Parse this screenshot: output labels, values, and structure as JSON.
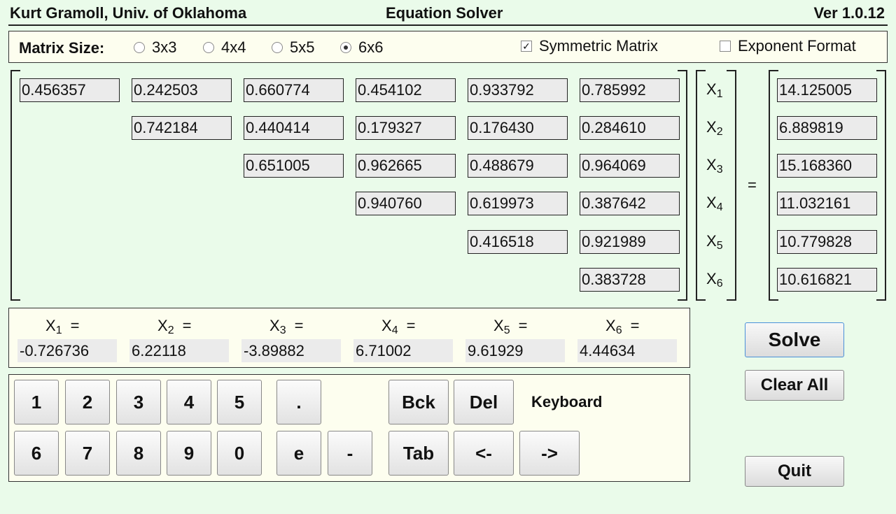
{
  "header": {
    "author": "Kurt Gramoll, Univ. of Oklahoma",
    "title": "Equation Solver",
    "version": "Ver 1.0.12"
  },
  "options": {
    "matrix_size_label": "Matrix Size:",
    "sizes": [
      {
        "label": "3x3",
        "selected": false
      },
      {
        "label": "4x4",
        "selected": false
      },
      {
        "label": "5x5",
        "selected": false
      },
      {
        "label": "6x6",
        "selected": true
      }
    ],
    "symmetric": {
      "label": "Symmetric Matrix",
      "checked": true,
      "mark": "✓"
    },
    "exponent": {
      "label": "Exponent Format",
      "checked": false
    }
  },
  "matrix": {
    "rows": [
      [
        "0.456357",
        "0.242503",
        "0.660774",
        "0.454102",
        "0.933792",
        "0.785992"
      ],
      [
        "0.742184",
        "0.440414",
        "0.179327",
        "0.176430",
        "0.284610"
      ],
      [
        "0.651005",
        "0.962665",
        "0.488679",
        "0.964069"
      ],
      [
        "0.940760",
        "0.619973",
        "0.387642"
      ],
      [
        "0.416518",
        "0.921989"
      ],
      [
        "0.383728"
      ]
    ]
  },
  "variables": {
    "letter": "X",
    "indices": [
      "1",
      "2",
      "3",
      "4",
      "5",
      "6"
    ]
  },
  "equals": "=",
  "rhs": [
    "14.125005",
    "6.889819",
    "15.168360",
    "11.032161",
    "10.779828",
    "10.616821"
  ],
  "results": {
    "values": [
      "-0.726736",
      "6.22118",
      "-3.89882",
      "6.71002",
      "9.61929",
      "4.44634"
    ]
  },
  "keypad": {
    "row1": [
      "1",
      "2",
      "3",
      "4",
      "5",
      ".",
      "Bck",
      "Del"
    ],
    "row2": [
      "6",
      "7",
      "8",
      "9",
      "0",
      "e",
      "-",
      "Tab",
      "<-",
      "->"
    ],
    "label": "Keyboard"
  },
  "buttons": {
    "solve": "Solve",
    "clear_all": "Clear All",
    "quit": "Quit"
  }
}
